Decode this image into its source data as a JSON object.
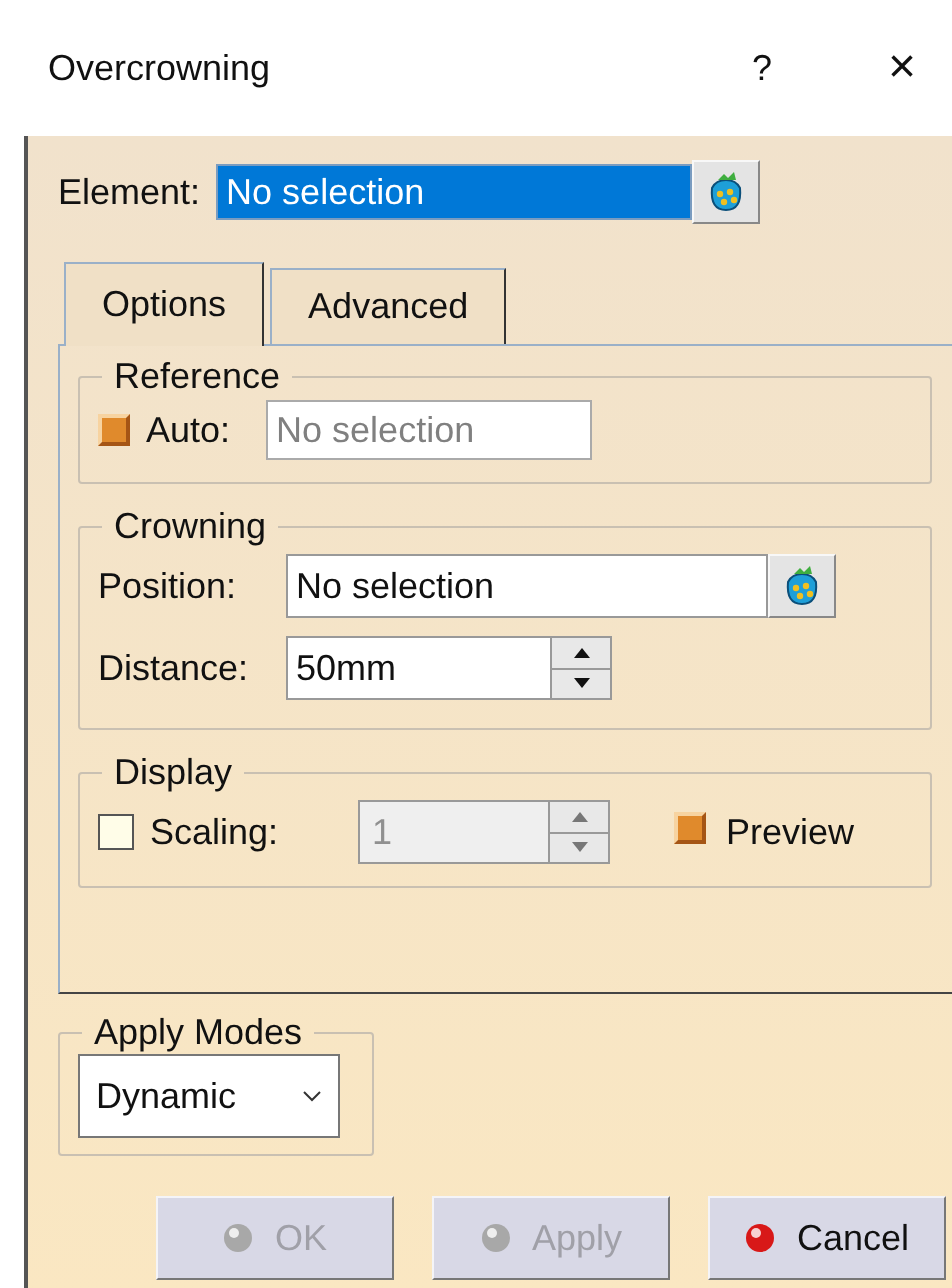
{
  "window": {
    "title": "Overcrowning",
    "help": "?",
    "close": "×"
  },
  "element": {
    "label": "Element:",
    "value": "No selection",
    "selected": true
  },
  "tabs": [
    {
      "label": "Options",
      "selected": true
    },
    {
      "label": "Advanced",
      "selected": false
    }
  ],
  "reference": {
    "title": "Reference",
    "auto": {
      "label": "Auto:",
      "checked": true
    },
    "field": {
      "value": "No selection",
      "disabled": true
    }
  },
  "crowning": {
    "title": "Crowning",
    "position": {
      "label": "Position:",
      "value": "No selection"
    },
    "distance": {
      "label": "Distance:",
      "value": "50mm"
    }
  },
  "display": {
    "title": "Display",
    "scaling": {
      "label": "Scaling:",
      "checked": false
    },
    "scaling_value": {
      "value": "1",
      "disabled": true
    },
    "preview": {
      "label": "Preview",
      "checked": true
    }
  },
  "apply_modes": {
    "title": "Apply Modes",
    "value": "Dynamic"
  },
  "buttons": [
    {
      "label": "OK",
      "kind": "ok",
      "disabled": true
    },
    {
      "label": "Apply",
      "kind": "apply",
      "disabled": true
    },
    {
      "label": "Cancel",
      "kind": "cancel",
      "disabled": false
    }
  ]
}
